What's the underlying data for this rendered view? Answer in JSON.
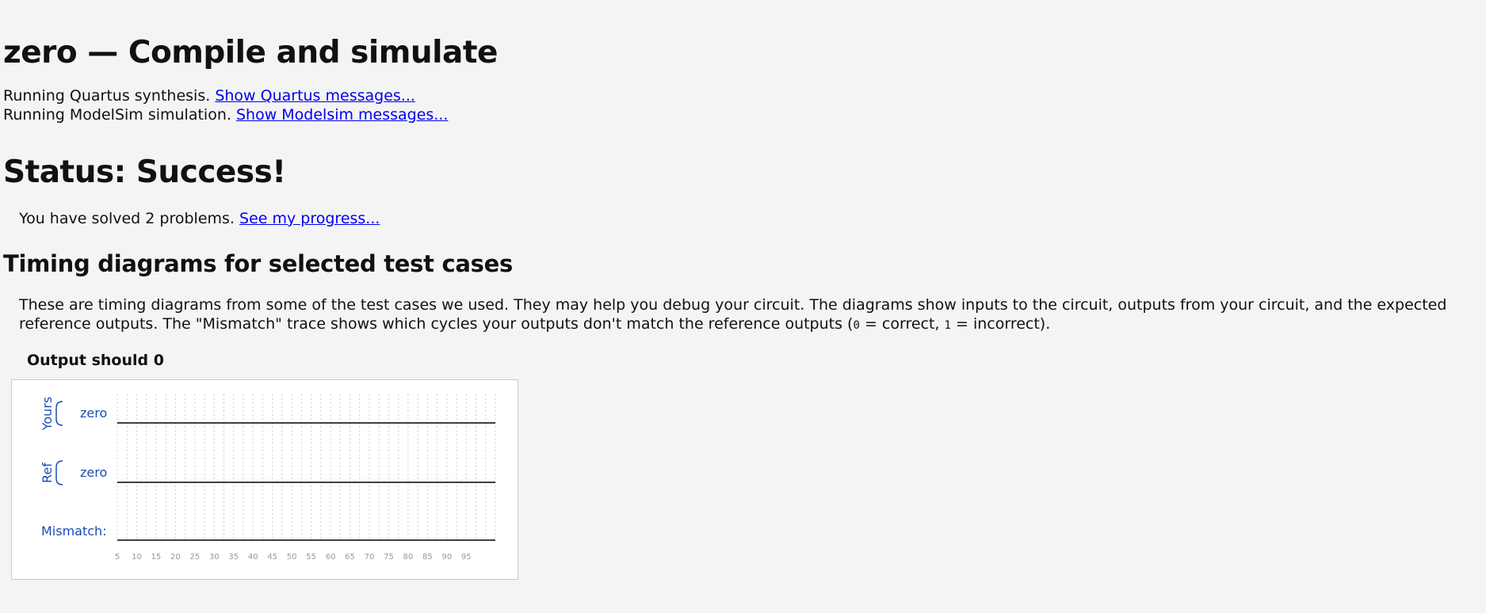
{
  "header": {
    "title": "zero — Compile and simulate"
  },
  "runs": {
    "quartus_text": "Running Quartus synthesis.",
    "quartus_link": "Show Quartus messages...",
    "modelsim_text": "Running ModelSim simulation.",
    "modelsim_link": "Show Modelsim messages..."
  },
  "status": {
    "title": "Status: Success!",
    "solved_text": "You have solved 2 problems.",
    "progress_link": "See my progress..."
  },
  "timing": {
    "heading": "Timing diagrams for selected test cases",
    "desc_part1": "These are timing diagrams from some of the test cases we used. They may help you debug your circuit. The diagrams show inputs to the circuit, outputs from your circuit, and the expected reference outputs. The \"Mismatch\" trace shows which cycles your outputs don't match the reference outputs (",
    "desc_zero": "0",
    "desc_part2": " = correct, ",
    "desc_one": "1",
    "desc_part3": " = incorrect).",
    "diagram_title": "Output should 0"
  },
  "waveform": {
    "groups": [
      {
        "label": "Yours",
        "signal": "zero"
      },
      {
        "label": "Ref",
        "signal": "zero"
      }
    ],
    "mismatch_label": "Mismatch:",
    "ticks": [
      "5",
      "10",
      "15",
      "20",
      "25",
      "30",
      "35",
      "40",
      "45",
      "50",
      "55",
      "60",
      "65",
      "70",
      "75",
      "80",
      "85",
      "90",
      "95"
    ],
    "colors": {
      "label": "#1a4bb5",
      "grid": "#cccccc",
      "trace": "#000000"
    }
  }
}
